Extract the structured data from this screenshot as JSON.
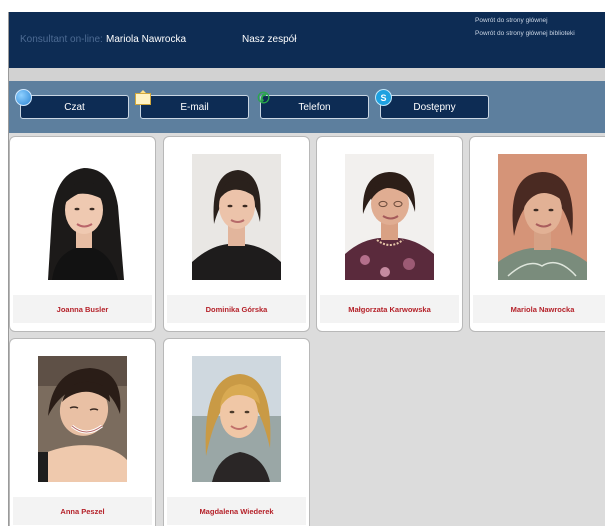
{
  "header": {
    "consultant_label": "Konsultant on-line:",
    "consultant_name": "Mariola Nawrocka",
    "team_link": "Nasz zespół",
    "return_links": [
      "Powrót do strony głównej",
      "Powrót do strony głównej biblioteki"
    ]
  },
  "toolbar": {
    "buttons": [
      {
        "label": "Czat",
        "icon": "chat-bubble-icon"
      },
      {
        "label": "E-mail",
        "icon": "envelope-icon"
      },
      {
        "label": "Telefon",
        "icon": "phone-icon"
      },
      {
        "label": "Dostępny",
        "icon": "skype-icon"
      }
    ]
  },
  "team": [
    {
      "name": "Joanna Busler"
    },
    {
      "name": "Dominika Górska"
    },
    {
      "name": "Małgorzata Karwowska"
    },
    {
      "name": "Mariola Nawrocka"
    },
    {
      "name": "Anna Peszel"
    },
    {
      "name": "Magdalena Wiederek"
    }
  ],
  "colors": {
    "header_bg": "#0d2c54",
    "toolbar_bg": "#5d7f9e",
    "name_text": "#b5222a",
    "content_bg": "#dcdcdc"
  }
}
